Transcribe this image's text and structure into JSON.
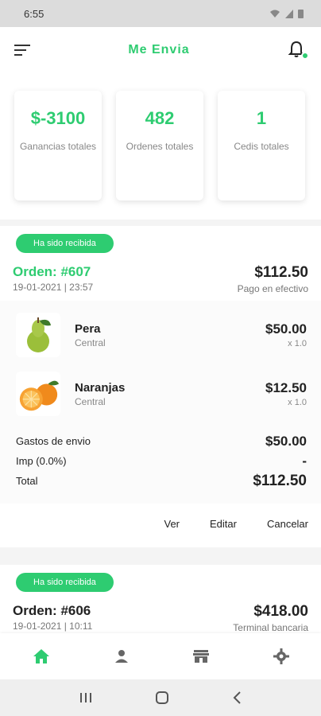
{
  "status": {
    "time": "6:55"
  },
  "header": {
    "title": "Me Envia"
  },
  "stats": [
    {
      "value": "$-3100",
      "label": "Ganancias totales"
    },
    {
      "value": "482",
      "label": "Ordenes totales"
    },
    {
      "value": "1",
      "label": "Cedis totales"
    }
  ],
  "orders": [
    {
      "status": "Ha sido recibida",
      "id": "Orden: #607",
      "date": "19-01-2021 | 23:57",
      "total": "$112.50",
      "payment": "Pago en efectivo",
      "items": [
        {
          "name": "Pera",
          "store": "Central",
          "price": "$50.00",
          "qty": "x 1.0",
          "icon": "pear-image"
        },
        {
          "name": "Naranjas",
          "store": "Central",
          "price": "$12.50",
          "qty": "x 1.0",
          "icon": "oranges-image"
        }
      ],
      "shipping_label": "Gastos de envio",
      "shipping_value": "$50.00",
      "tax_label": "Imp (0.0%)",
      "tax_value": "-",
      "total_label": "Total",
      "total_value": "$112.50",
      "actions": {
        "view": "Ver",
        "edit": "Editar",
        "cancel": "Cancelar"
      }
    },
    {
      "status": "Ha sido recibida",
      "id": "Orden: #606",
      "date": "19-01-2021 | 10:11",
      "total": "$418.00",
      "payment": "Terminal bancaria"
    }
  ],
  "nav": [
    "home-icon",
    "person-icon",
    "store-icon",
    "settings-icon"
  ],
  "colors": {
    "accent": "#2ecc71"
  }
}
